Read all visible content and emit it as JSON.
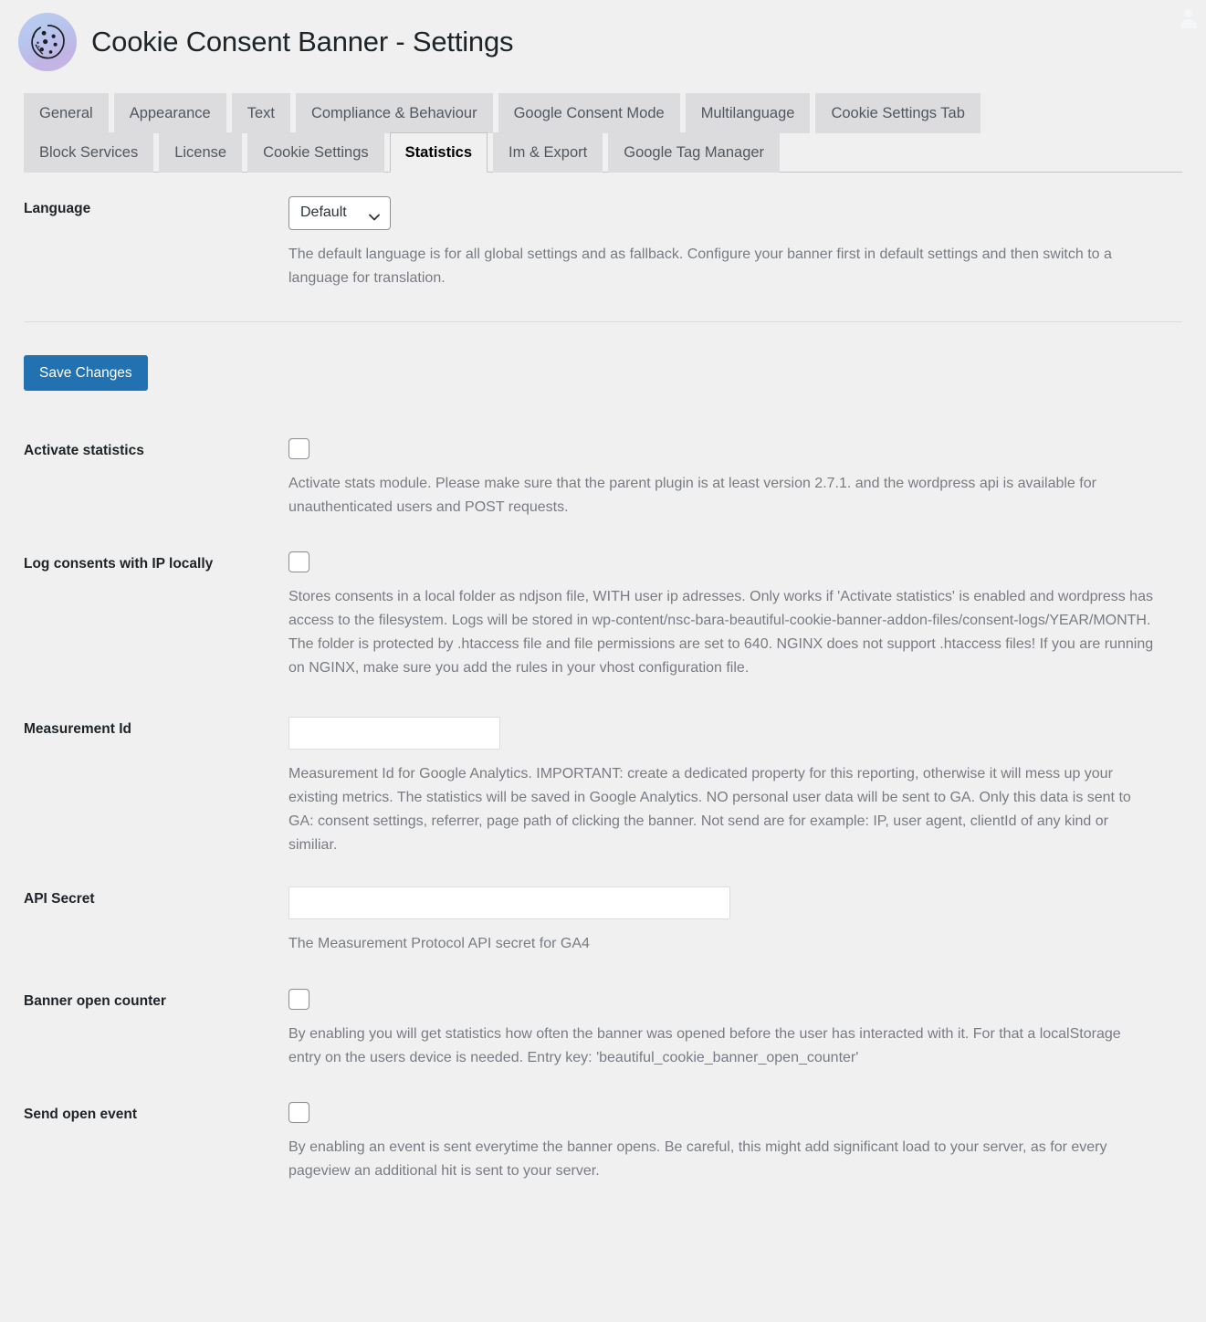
{
  "header": {
    "title": "Cookie Consent Banner - Settings",
    "logo_icon": "cookie-icon",
    "avatar_icon": "user-avatar-icon"
  },
  "tabs": {
    "row1": [
      {
        "label": "General",
        "active": false
      },
      {
        "label": "Appearance",
        "active": false
      },
      {
        "label": "Text",
        "active": false
      },
      {
        "label": "Compliance & Behaviour",
        "active": false
      },
      {
        "label": "Google Consent Mode",
        "active": false
      },
      {
        "label": "Multilanguage",
        "active": false
      },
      {
        "label": "Cookie Settings Tab",
        "active": false
      }
    ],
    "row2": [
      {
        "label": "Block Services",
        "active": false
      },
      {
        "label": "License",
        "active": false
      },
      {
        "label": "Cookie Settings",
        "active": false
      },
      {
        "label": "Statistics",
        "active": true
      },
      {
        "label": "Im & Export",
        "active": false
      },
      {
        "label": "Google Tag Manager",
        "active": false
      }
    ]
  },
  "language": {
    "label": "Language",
    "selected": "Default",
    "options": [
      "Default"
    ],
    "description": "The default language is for all global settings and as fallback. Configure your banner first in default settings and then switch to a language for translation."
  },
  "save": {
    "label": "Save Changes"
  },
  "fields": {
    "activate_statistics": {
      "label": "Activate statistics",
      "checked": false,
      "description": "Activate stats module. Please make sure that the parent plugin is at least version 2.7.1. and the wordpress api is available for unauthenticated users and POST requests."
    },
    "log_consents": {
      "label": "Log consents with IP locally",
      "checked": false,
      "description": "Stores consents in a local folder as ndjson file, WITH user ip adresses. Only works if 'Activate statistics' is enabled and wordpress has access to the filesystem. Logs will be stored in wp-content/nsc-bara-beautiful-cookie-banner-addon-files/consent-logs/YEAR/MONTH. The folder is protected by .htaccess file and file permissions are set to 640. NGINX does not support .htaccess files! If you are running on NGINX, make sure you add the rules in your vhost configuration file."
    },
    "measurement_id": {
      "label": "Measurement Id",
      "value": "",
      "placeholder": "",
      "description": "Measurement Id for Google Analytics. IMPORTANT: create a dedicated property for this reporting, otherwise it will mess up your existing metrics. The statistics will be saved in Google Analytics. NO personal user data will be sent to GA. Only this data is sent to GA: consent settings, referrer, page path of clicking the banner. Not send are for example: IP, user agent, clientId of any kind or similiar."
    },
    "api_secret": {
      "label": "API Secret",
      "value": "",
      "placeholder": "",
      "description": "The Measurement Protocol API secret for GA4"
    },
    "banner_open_counter": {
      "label": "Banner open counter",
      "checked": false,
      "description": "By enabling you will get statistics how often the banner was opened before the user has interacted with it. For that a localStorage entry on the users device is needed. Entry key: 'beautiful_cookie_banner_open_counter'"
    },
    "send_open_event": {
      "label": "Send open event",
      "checked": false,
      "description": "By enabling an event is sent everytime the banner opens. Be careful, this might add significant load to your server, as for every pageview an additional hit is sent to your server."
    }
  },
  "colors": {
    "page_background": "#f0f0f1",
    "tab_background": "#dcdcde",
    "tab_text": "#50575e",
    "primary_button": "#2271b1",
    "description_text": "#787c82",
    "label_text": "#1d2327"
  }
}
